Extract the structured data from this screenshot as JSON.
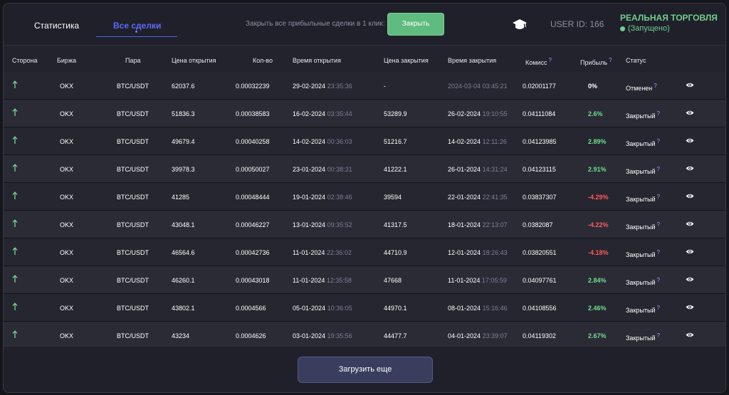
{
  "tabs": [
    {
      "label": "Статистика"
    },
    {
      "label": "Все сделки"
    }
  ],
  "close_all": {
    "text": "Закрыть все прибыльные сделки в 1 клик:",
    "button": "Закрыть"
  },
  "user": {
    "id_label": "USER ID: 166"
  },
  "trading": {
    "mode": "РЕАЛЬНАЯ ТОРГОВЛЯ",
    "status": "(Запущено)"
  },
  "columns": [
    "Сторона",
    "Биржа",
    "Пара",
    "Цена открытия",
    "Кол-во",
    "Время открытия",
    "Цена закрытия",
    "Время закрытия",
    "Комисс",
    "Прибыль",
    "Статус"
  ],
  "rows": [
    {
      "exchange": "OKX",
      "pair": "BTC/USDT",
      "open_price": "62037.6",
      "qty": "0.00032239",
      "open_date": "29-02-2024",
      "open_time": "23:35:36",
      "close_price": "-",
      "close_date": "",
      "close_time": "2024-03-04 03:45:21",
      "fee": "0.02001177",
      "profit": "0%",
      "profit_sign": "zero",
      "status": "Отменен"
    },
    {
      "exchange": "OKX",
      "pair": "BTC/USDT",
      "open_price": "51836.3",
      "qty": "0.00038583",
      "open_date": "16-02-2024",
      "open_time": "03:35:44",
      "close_price": "53289.9",
      "close_date": "26-02-2024",
      "close_time": "19:10:55",
      "fee": "0.04111084",
      "profit": "2.6%",
      "profit_sign": "pos",
      "status": "Закрытый"
    },
    {
      "exchange": "OKX",
      "pair": "BTC/USDT",
      "open_price": "49679.4",
      "qty": "0.00040258",
      "open_date": "14-02-2024",
      "open_time": "00:36:03",
      "close_price": "51216.7",
      "close_date": "14-02-2024",
      "close_time": "12:11:26",
      "fee": "0.04123985",
      "profit": "2.89%",
      "profit_sign": "pos",
      "status": "Закрытый"
    },
    {
      "exchange": "OKX",
      "pair": "BTC/USDT",
      "open_price": "39978.3",
      "qty": "0.00050027",
      "open_date": "23-01-2024",
      "open_time": "00:38:31",
      "close_price": "41222.1",
      "close_date": "26-01-2024",
      "close_time": "14:31:24",
      "fee": "0.04123115",
      "profit": "2.91%",
      "profit_sign": "pos",
      "status": "Закрытый"
    },
    {
      "exchange": "OKX",
      "pair": "BTC/USDT",
      "open_price": "41285",
      "qty": "0.00048444",
      "open_date": "19-01-2024",
      "open_time": "02:38:46",
      "close_price": "39594",
      "close_date": "22-01-2024",
      "close_time": "22:41:35",
      "fee": "0.03837307",
      "profit": "-4.29%",
      "profit_sign": "neg",
      "status": "Закрытый"
    },
    {
      "exchange": "OKX",
      "pair": "BTC/USDT",
      "open_price": "43048.1",
      "qty": "0.00046227",
      "open_date": "13-01-2024",
      "open_time": "09:35:52",
      "close_price": "41317.5",
      "close_date": "18-01-2024",
      "close_time": "22:13:07",
      "fee": "0.0382087",
      "profit": "-4.22%",
      "profit_sign": "neg",
      "status": "Закрытый"
    },
    {
      "exchange": "OKX",
      "pair": "BTC/USDT",
      "open_price": "46564.6",
      "qty": "0.00042736",
      "open_date": "11-01-2024",
      "open_time": "22:36:02",
      "close_price": "44710.9",
      "close_date": "12-01-2024",
      "close_time": "18:26:43",
      "fee": "0.03820551",
      "profit": "-4.18%",
      "profit_sign": "neg",
      "status": "Закрытый"
    },
    {
      "exchange": "OKX",
      "pair": "BTC/USDT",
      "open_price": "46260.1",
      "qty": "0.00043018",
      "open_date": "11-01-2024",
      "open_time": "12:35:58",
      "close_price": "47668",
      "close_date": "11-01-2024",
      "close_time": "17:05:59",
      "fee": "0.04097761",
      "profit": "2.84%",
      "profit_sign": "pos",
      "status": "Закрытый"
    },
    {
      "exchange": "OKX",
      "pair": "BTC/USDT",
      "open_price": "43802.1",
      "qty": "0.0004566",
      "open_date": "05-01-2024",
      "open_time": "10:36:05",
      "close_price": "44970.1",
      "close_date": "08-01-2024",
      "close_time": "15:16:46",
      "fee": "0.04108556",
      "profit": "2.46%",
      "profit_sign": "pos",
      "status": "Закрытый"
    },
    {
      "exchange": "OKX",
      "pair": "BTC/USDT",
      "open_price": "43234",
      "qty": "0.0004626",
      "open_date": "03-01-2024",
      "open_time": "19:35:56",
      "close_price": "44477.7",
      "close_date": "04-01-2024",
      "close_time": "23:39:07",
      "fee": "0.04119302",
      "profit": "2.67%",
      "profit_sign": "pos",
      "status": "Закрытый"
    }
  ],
  "help_mark": "?",
  "load_more": "Загрузить еще",
  "colors": {
    "accent": "#5b6cff",
    "profit_pos": "#6fdf8f",
    "profit_neg": "#ff5a5a",
    "close_btn": "#5fbb7e"
  },
  "icons": {
    "side": "arrow-up-icon",
    "view": "eye-icon",
    "user": "graduation-cap-icon"
  }
}
